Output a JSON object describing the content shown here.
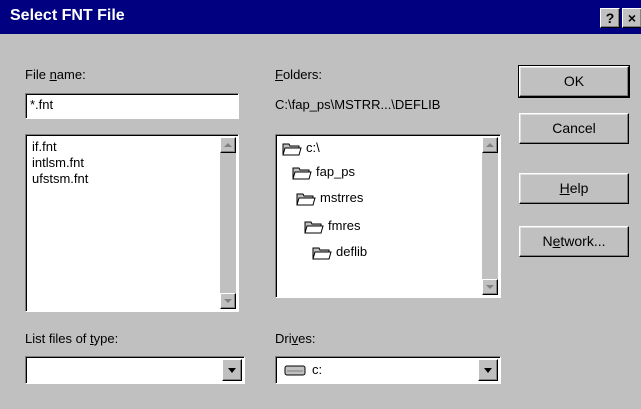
{
  "window": {
    "title": "Select FNT File",
    "help_button": "?",
    "close_button": "×"
  },
  "file_name": {
    "label_pre": "File ",
    "label_ul": "n",
    "label_post": "ame:",
    "value": "*.fnt",
    "files": [
      "if.fnt",
      "intlsm.fnt",
      "ufstsm.fnt"
    ]
  },
  "folders": {
    "label_ul": "F",
    "label_post": "olders:",
    "current_path": "C:\\fap_ps\\MSTRR...\\DEFLIB",
    "tree": [
      {
        "name": "c:\\",
        "icon": "open-folder-icon"
      },
      {
        "name": "fap_ps",
        "icon": "open-folder-icon"
      },
      {
        "name": "mstrres",
        "icon": "open-folder-icon"
      },
      {
        "name": "fmres",
        "icon": "open-folder-icon"
      },
      {
        "name": "deflib",
        "icon": "open-folder-icon"
      }
    ]
  },
  "buttons": {
    "ok": "OK",
    "cancel": "Cancel",
    "help_ul": "H",
    "help_post": "elp",
    "network_pre": "N",
    "network_ul": "e",
    "network_post": "twork..."
  },
  "file_type": {
    "label_pre": "List files of ",
    "label_ul": "t",
    "label_post": "ype:",
    "selected": ""
  },
  "drives": {
    "label_pre": "Dri",
    "label_ul": "v",
    "label_post": "es:",
    "selected": "c:",
    "icon": "drive-icon"
  },
  "colors": {
    "title_bar": "#000080",
    "face": "#c0c0c0"
  }
}
